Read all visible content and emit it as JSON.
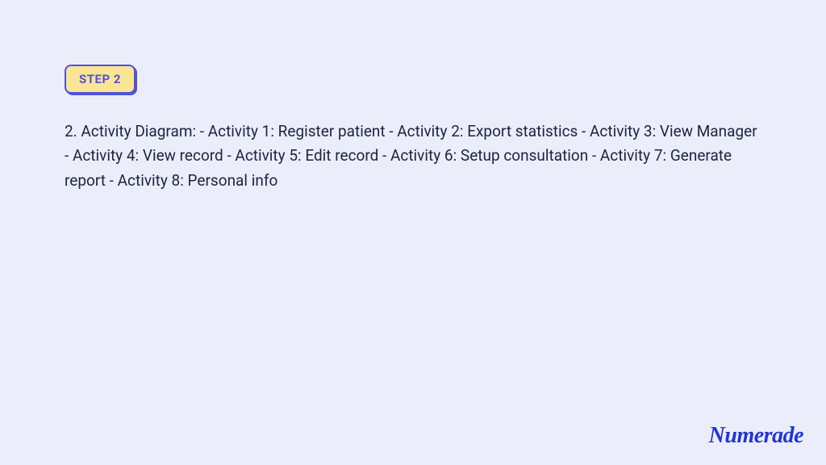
{
  "step": {
    "badge_label": "STEP 2",
    "body": "2. Activity Diagram: - Activity 1: Register patient - Activity 2: Export statistics - Activity 3: View Manager - Activity 4: View record - Activity 5: Edit record - Activity 6: Setup consultation - Activity 7: Generate report - Activity 8: Personal info"
  },
  "brand": {
    "name": "Numerade"
  }
}
